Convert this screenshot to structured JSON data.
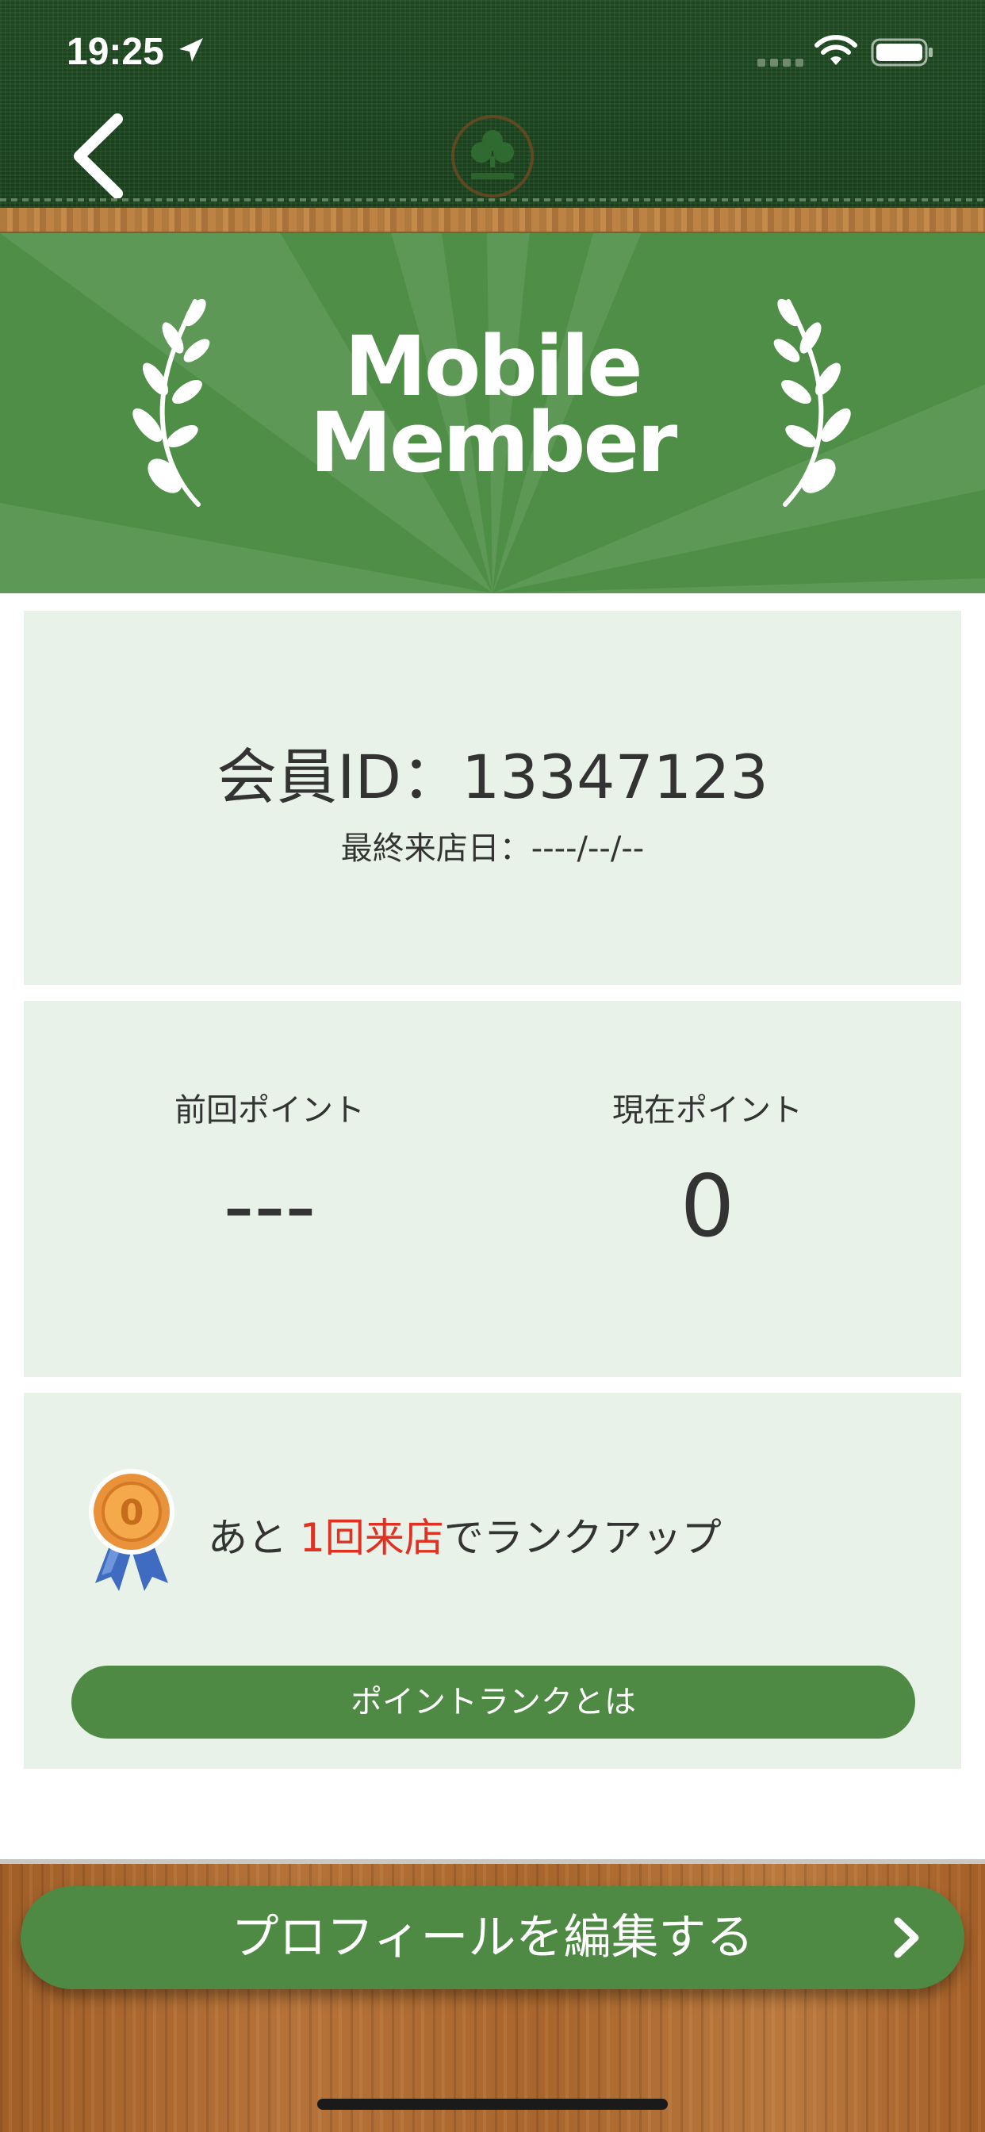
{
  "status_bar": {
    "time": "19:25",
    "icons": [
      "location-arrow-icon",
      "cellular-signal-icon",
      "wifi-icon",
      "battery-icon"
    ]
  },
  "header": {
    "back_icon": "chevron-left-icon",
    "logo_icon": "clover-logo-icon"
  },
  "banner": {
    "title_line1": "Mobile",
    "title_line2": "Member",
    "decoration_icons": [
      "laurel-branch-icon",
      "laurel-branch-icon"
    ]
  },
  "member_card": {
    "member_id": "会員ID：13347123",
    "last_visit": "最終来店日：----/--/--"
  },
  "points_card": {
    "previous_label": "前回ポイント",
    "previous_value": "---",
    "current_label": "現在ポイント",
    "current_value": "0"
  },
  "rank_card": {
    "medal_icon": "bronze-medal-ribbon-icon",
    "medal_digit": "0",
    "text_before": "あと ",
    "text_highlight": "1回来店",
    "text_after": "でランクアップ",
    "button_label": "ポイントランクとは"
  },
  "footer": {
    "edit_profile_label": "プロフィールを編集する",
    "chevron_icon": "chevron-right-icon"
  },
  "colors": {
    "header_green": "#1f4a22",
    "banner_green": "#4f8e47",
    "button_green": "#4f8a45",
    "card_background": "#e8f2e8",
    "highlight_red": "#e03223",
    "wood_brown": "#a9652c"
  }
}
